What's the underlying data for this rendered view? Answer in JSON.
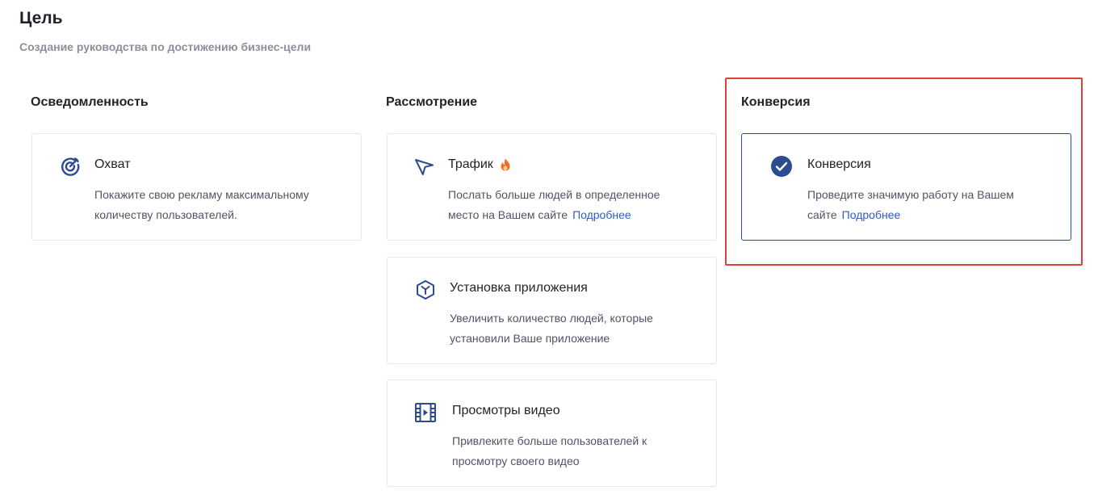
{
  "header": {
    "title": "Цель",
    "subtitle": "Создание руководства по достижению бизнес-цели"
  },
  "columns": [
    {
      "title": "Осведомленность",
      "cards": [
        {
          "icon": "target-icon",
          "title": "Охват",
          "description": "Покажите свою рекламу максимальному количеству пользователей.",
          "link": ""
        }
      ]
    },
    {
      "title": "Рассмотрение",
      "cards": [
        {
          "icon": "cursor-arrow-icon",
          "title": "Трафик",
          "badge_icon": "fire-icon",
          "description": "Послать больше людей в определенное место на Вашем сайте",
          "link": "Подробнее"
        },
        {
          "icon": "app-cube-icon",
          "title": "Установка приложения",
          "description": "Увеличить количество людей, которые установили Ваше приложение",
          "link": ""
        },
        {
          "icon": "video-film-icon",
          "title": "Просмотры видео",
          "description": "Привлеките больше пользователей к просмотру своего видео",
          "link": ""
        }
      ]
    },
    {
      "title": "Конверсия",
      "highlighted": true,
      "cards": [
        {
          "icon": "check-circle-icon",
          "title": "Конверсия",
          "description": "Проведите значимую работу на Вашем сайте",
          "link": "Подробнее",
          "selected": true
        }
      ]
    }
  ],
  "colors": {
    "accent": "#2d4c8f",
    "link": "#2d5bb9",
    "highlight_border": "#e0413a",
    "fire": "#f26b2a"
  }
}
